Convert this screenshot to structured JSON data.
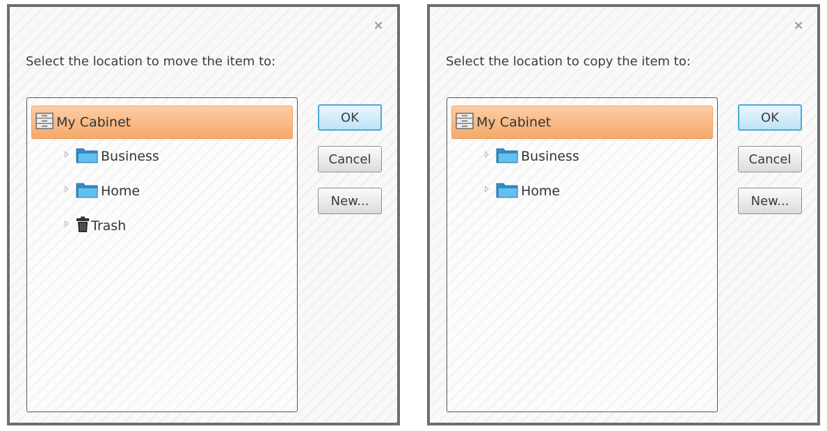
{
  "dialogs": {
    "move": {
      "close_glyph": "×",
      "prompt": "Select the location to move the item to:",
      "root_label": "My Cabinet",
      "items": [
        "Business",
        "Home",
        "Trash"
      ],
      "ok": "OK",
      "cancel": "Cancel",
      "new": "New..."
    },
    "copy": {
      "close_glyph": "×",
      "prompt": "Select the location to copy the item to:",
      "root_label": "My Cabinet",
      "items": [
        "Business",
        "Home"
      ],
      "ok": "OK",
      "cancel": "Cancel",
      "new": "New..."
    }
  },
  "icons": {
    "root": "cabinet-icon",
    "folder": "folder-icon",
    "trash": "trash-icon",
    "expander": "expand-arrow-icon",
    "close": "close-icon"
  },
  "colors": {
    "selection": "#f5a96a",
    "ok_border": "#4aa8d8",
    "folder_blue": "#3fa9e0"
  }
}
